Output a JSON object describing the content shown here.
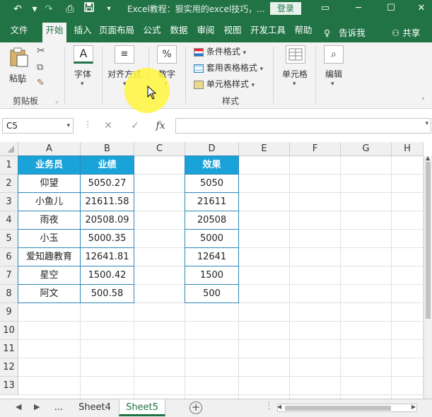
{
  "window": {
    "title": "Excel教程：狠实用的excel技巧，...",
    "login_label": "登录",
    "colors": {
      "brand": "#217346",
      "header_fill": "#1aa3d8",
      "border": "#2e86b8"
    }
  },
  "quick_access": [
    {
      "name": "undo-icon",
      "glyph": "↶"
    },
    {
      "name": "redo-icon",
      "glyph": "↷"
    },
    {
      "name": "print-preview-icon",
      "glyph": "⎙"
    },
    {
      "name": "save-icon",
      "glyph": "▪"
    },
    {
      "name": "customize-qat-icon",
      "glyph": "▾"
    }
  ],
  "window_controls": {
    "ribbon_options": "▭",
    "minimize": "─",
    "maximize": "☐",
    "close": "✕"
  },
  "ribbon_tabs": [
    "文件",
    "开始",
    "插入",
    "页面布局",
    "公式",
    "数据",
    "审阅",
    "视图",
    "开发工具",
    "帮助"
  ],
  "ribbon_active_tab": "开始",
  "tell_me": "告诉我",
  "share": "共享",
  "ribbon": {
    "paste": "粘贴",
    "clipboard_group": "剪贴板",
    "font": "字体",
    "alignment": "对齐方式",
    "number": "数字",
    "number_symbol": "%",
    "conditional_format": "条件格式",
    "table_format": "套用表格格式",
    "cell_style": "单元格样式",
    "styles_group": "样式",
    "cells": "单元格",
    "editing": "编辑",
    "font_symbol": "A"
  },
  "formula_bar": {
    "name_box": "C5",
    "cancel": "✕",
    "enter": "✓",
    "fx": "fx",
    "formula": ""
  },
  "grid": {
    "columns": [
      "A",
      "B",
      "C",
      "D",
      "E",
      "F",
      "G",
      "H"
    ],
    "rows": [
      "1",
      "2",
      "3",
      "4",
      "5",
      "6",
      "7",
      "8",
      "9",
      "10",
      "11",
      "12",
      "13"
    ],
    "table1_headers": [
      "业务员",
      "业绩"
    ],
    "table1_rows": [
      [
        "仰望",
        "5050.27"
      ],
      [
        "小鱼儿",
        "21611.58"
      ],
      [
        "雨夜",
        "20508.09"
      ],
      [
        "小玉",
        "5000.35"
      ],
      [
        "爱知趣教育",
        "12641.81"
      ],
      [
        "星空",
        "1500.42"
      ],
      [
        "阿文",
        "500.58"
      ]
    ],
    "table2_header": "效果",
    "table2_rows": [
      "5050",
      "21611",
      "20508",
      "5000",
      "12641",
      "1500",
      "500"
    ]
  },
  "sheets": {
    "ellipsis": "...",
    "tabs": [
      "Sheet4",
      "Sheet5"
    ],
    "active": "Sheet5",
    "add": "+"
  }
}
